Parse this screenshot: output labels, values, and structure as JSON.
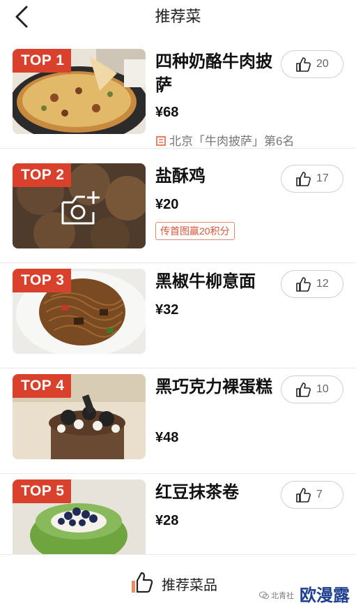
{
  "header": {
    "title": "推荐菜",
    "back_icon": "chevron-left-icon"
  },
  "dishes": [
    {
      "rank": "TOP 1",
      "name": "四种奶酪牛肉披萨",
      "price": "¥68",
      "likes": "20",
      "rank_info": "北京「牛肉披萨」第6名",
      "image": "pizza"
    },
    {
      "rank": "TOP 2",
      "name": "盐酥鸡",
      "price": "¥20",
      "likes": "17",
      "badge": "传首图赢20积分",
      "image": "no-photo-camera"
    },
    {
      "rank": "TOP 3",
      "name": "黑椒牛柳意面",
      "price": "¥32",
      "likes": "12",
      "image": "pasta"
    },
    {
      "rank": "TOP 4",
      "name": "黑巧克力裸蛋糕",
      "price": "¥48",
      "likes": "10",
      "image": "chocolate-cake"
    },
    {
      "rank": "TOP 5",
      "name": "红豆抹茶卷",
      "price": "¥28",
      "likes": "7",
      "image": "matcha-roll"
    }
  ],
  "bottom_bar": {
    "recommend_label": "推荐菜品"
  },
  "watermark": {
    "small": "北青社",
    "big": "欧漫露"
  },
  "colors": {
    "rank_tag": "#d9412c",
    "badge": "#d9563a",
    "watermark": "#1e3f8f"
  }
}
